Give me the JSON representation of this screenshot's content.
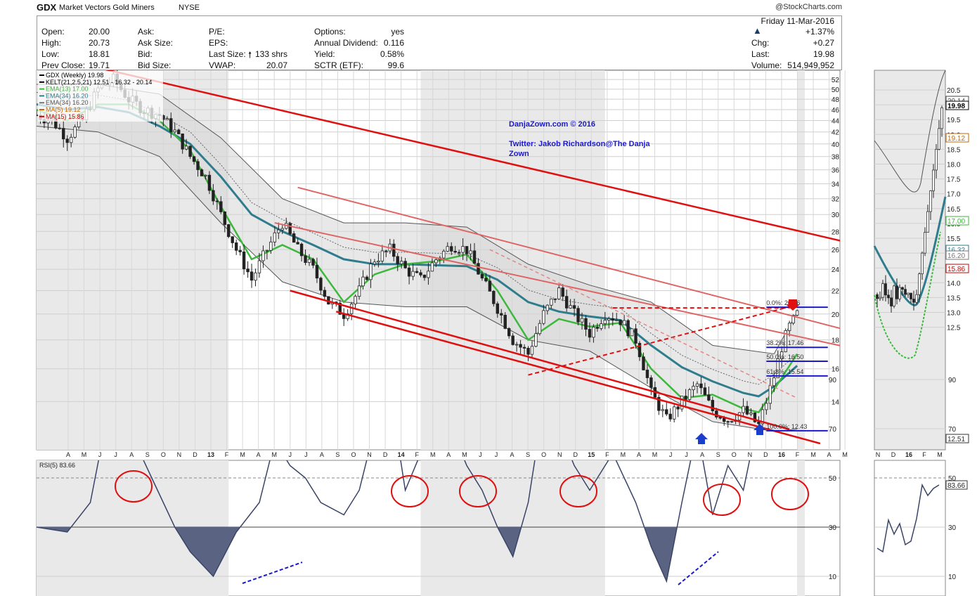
{
  "header": {
    "symbol": "GDX",
    "name": "Market Vectors Gold Miners",
    "exchange": "NYSE",
    "logo": "@StockCharts.com"
  },
  "quote": {
    "col1": [
      {
        "label": "Open:",
        "value": "20.00"
      },
      {
        "label": "High:",
        "value": "20.73"
      },
      {
        "label": "Low:",
        "value": "18.81"
      },
      {
        "label": "Prev Close:",
        "value": "19.71"
      }
    ],
    "col2": [
      {
        "label": "Ask:",
        "value": ""
      },
      {
        "label": "Ask Size:",
        "value": ""
      },
      {
        "label": "Bid:",
        "value": ""
      },
      {
        "label": "Bid Size:",
        "value": ""
      }
    ],
    "col3": [
      {
        "label": "P/E:",
        "value": ""
      },
      {
        "label": "EPS:",
        "value": ""
      },
      {
        "label": "Last Size:",
        "value": "133 shrs"
      },
      {
        "label": "VWAP:",
        "value": "20.07"
      }
    ],
    "col4": [
      {
        "label": "Options:",
        "value": "yes"
      },
      {
        "label": "Annual Dividend:",
        "value": "0.116"
      },
      {
        "label": "Yield:",
        "value": "0.58%"
      },
      {
        "label": "SCTR (ETF):",
        "value": "99.6"
      }
    ],
    "date": "Friday 11-Mar-2016",
    "change_pct": "+1.37%",
    "col5": [
      {
        "label": "Chg:",
        "value": "+0.27"
      },
      {
        "label": "Last:",
        "value": "19.98"
      },
      {
        "label": "Volume:",
        "value": "514,949,952"
      }
    ],
    "up_color": "#1a3d6a"
  },
  "legend": [
    {
      "text": "GDX (Weekly) 19.98",
      "color": "#000000"
    },
    {
      "text": "KELT(21,2.5,21) 12.51 - 16.32 - 20.14",
      "color": "#000000"
    },
    {
      "text": "EMA(13) 17.00",
      "color": "#3cb83c"
    },
    {
      "text": "EMA(34) 16.20",
      "color": "#2f7d8c"
    },
    {
      "text": "EMA(34) 16.20",
      "color": "#777777"
    },
    {
      "text": "MA(5) 19.12",
      "color": "#cc6600"
    },
    {
      "text": "MA(15) 15.86",
      "color": "#cc0000"
    }
  ],
  "watermark": {
    "line1": "DanjaZown.com © 2016",
    "line2": "Twitter: Jakob Richardson@The Danja",
    "line3": "Zown",
    "color": "#1a1acc"
  },
  "rsi": {
    "label": "RSI(5) 83.66",
    "ticks": [
      "90",
      "70",
      "50",
      "30",
      "10"
    ],
    "last": "83.66"
  },
  "side_labels": [
    "20.14",
    "19.98",
    "19.12",
    "17.00",
    "16.32",
    "16.20",
    "15.86",
    "12.51"
  ],
  "fib": [
    {
      "text": "0.0%: 20.56"
    },
    {
      "text": "38.2%: 17.46"
    },
    {
      "text": "50.0%: 16.50"
    },
    {
      "text": "61.8%: 15.54"
    },
    {
      "text": "100.0%: 12.43"
    }
  ],
  "chart_data": {
    "type": "line",
    "title": "GDX Market Vectors Gold Miners NYSE (Weekly)",
    "y_scale": "log",
    "ylim": [
      11.5,
      54
    ],
    "y_ticks": [
      52,
      50,
      48,
      46,
      44,
      42,
      40,
      38,
      36,
      34,
      32,
      30,
      28,
      26,
      24,
      22,
      20,
      18,
      16,
      14
    ],
    "x_ticks": [
      "A",
      "M",
      "J",
      "J",
      "A",
      "S",
      "O",
      "N",
      "D",
      "13",
      "F",
      "M",
      "A",
      "M",
      "J",
      "J",
      "A",
      "S",
      "O",
      "N",
      "D",
      "14",
      "F",
      "M",
      "A",
      "M",
      "J",
      "J",
      "A",
      "S",
      "O",
      "N",
      "D",
      "15",
      "F",
      "M",
      "A",
      "M",
      "J",
      "J",
      "A",
      "S",
      "O",
      "N",
      "D",
      "16",
      "F",
      "M",
      "A",
      "M"
    ],
    "price_path": [
      [
        0,
        45
      ],
      [
        4,
        44
      ],
      [
        8,
        41
      ],
      [
        12,
        44
      ],
      [
        16,
        50
      ],
      [
        20,
        52
      ],
      [
        24,
        48
      ],
      [
        28,
        46
      ],
      [
        32,
        45
      ],
      [
        36,
        42
      ],
      [
        40,
        38
      ],
      [
        44,
        35
      ],
      [
        48,
        30
      ],
      [
        52,
        26
      ],
      [
        56,
        23
      ],
      [
        60,
        26
      ],
      [
        64,
        29
      ],
      [
        68,
        26
      ],
      [
        72,
        24
      ],
      [
        76,
        21
      ],
      [
        80,
        20
      ],
      [
        84,
        22
      ],
      [
        88,
        25
      ],
      [
        92,
        26
      ],
      [
        96,
        24
      ],
      [
        100,
        23
      ],
      [
        104,
        25
      ],
      [
        108,
        26.5
      ],
      [
        112,
        26
      ],
      [
        116,
        23
      ],
      [
        120,
        20.5
      ],
      [
        124,
        18
      ],
      [
        128,
        17
      ],
      [
        132,
        20
      ],
      [
        136,
        22
      ],
      [
        140,
        20
      ],
      [
        144,
        18.5
      ],
      [
        148,
        20
      ],
      [
        152,
        19.5
      ],
      [
        156,
        18
      ],
      [
        160,
        14.5
      ],
      [
        164,
        13
      ],
      [
        168,
        14
      ],
      [
        172,
        15
      ],
      [
        176,
        13.5
      ],
      [
        180,
        13
      ],
      [
        184,
        13.5
      ],
      [
        188,
        12.7
      ],
      [
        190,
        14
      ],
      [
        192,
        15.5
      ],
      [
        194,
        17.5
      ],
      [
        196,
        19
      ],
      [
        198,
        19.98
      ]
    ],
    "series": [
      {
        "name": "EMA(13)",
        "values": [
          [
            0,
            46
          ],
          [
            8,
            44
          ],
          [
            16,
            47
          ],
          [
            24,
            47
          ],
          [
            32,
            44
          ],
          [
            40,
            39
          ],
          [
            48,
            31
          ],
          [
            56,
            25
          ],
          [
            64,
            26.5
          ],
          [
            72,
            25
          ],
          [
            80,
            21
          ],
          [
            88,
            23.5
          ],
          [
            96,
            24.5
          ],
          [
            104,
            24.8
          ],
          [
            112,
            25.5
          ],
          [
            120,
            22
          ],
          [
            128,
            18
          ],
          [
            136,
            19.6
          ],
          [
            144,
            19
          ],
          [
            152,
            19.3
          ],
          [
            160,
            16
          ],
          [
            168,
            14.2
          ],
          [
            176,
            14.4
          ],
          [
            184,
            13.6
          ],
          [
            188,
            13.4
          ],
          [
            192,
            14.7
          ],
          [
            198,
            17
          ]
        ]
      },
      {
        "name": "EMA(34)",
        "values": [
          [
            0,
            47
          ],
          [
            8,
            46
          ],
          [
            16,
            46.5
          ],
          [
            24,
            45.5
          ],
          [
            32,
            43
          ],
          [
            40,
            40
          ],
          [
            48,
            35
          ],
          [
            56,
            30
          ],
          [
            64,
            28
          ],
          [
            72,
            26.5
          ],
          [
            80,
            25
          ],
          [
            88,
            24.5
          ],
          [
            96,
            24.5
          ],
          [
            104,
            24.4
          ],
          [
            112,
            24.3
          ],
          [
            120,
            23
          ],
          [
            128,
            21
          ],
          [
            136,
            20.2
          ],
          [
            144,
            19.8
          ],
          [
            152,
            19.5
          ],
          [
            160,
            17.6
          ],
          [
            168,
            16.1
          ],
          [
            176,
            15.2
          ],
          [
            184,
            14.5
          ],
          [
            188,
            14.3
          ],
          [
            192,
            14.9
          ],
          [
            198,
            16.2
          ]
        ]
      },
      {
        "name": "KELT upper",
        "values": [
          [
            0,
            51
          ],
          [
            16,
            51
          ],
          [
            32,
            49
          ],
          [
            48,
            41
          ],
          [
            64,
            32
          ],
          [
            80,
            29
          ],
          [
            96,
            29
          ],
          [
            112,
            28.5
          ],
          [
            128,
            24.5
          ],
          [
            144,
            22.5
          ],
          [
            160,
            21
          ],
          [
            176,
            17.6
          ],
          [
            192,
            17
          ],
          [
            198,
            20.14
          ]
        ]
      },
      {
        "name": "KELT lower",
        "values": [
          [
            0,
            43
          ],
          [
            16,
            42
          ],
          [
            32,
            38
          ],
          [
            48,
            29
          ],
          [
            64,
            22.8
          ],
          [
            80,
            21
          ],
          [
            96,
            20.6
          ],
          [
            112,
            20.6
          ],
          [
            128,
            18
          ],
          [
            144,
            17.2
          ],
          [
            160,
            14.8
          ],
          [
            176,
            12.9
          ],
          [
            192,
            12.4
          ],
          [
            198,
            12.51
          ]
        ]
      }
    ],
    "trendlines": [
      {
        "from": [
          -10,
          60
        ],
        "to": [
          214,
          26.5
        ]
      },
      {
        "from": [
          66,
          22
        ],
        "to": [
          196,
          12.5
        ]
      },
      {
        "from": [
          78,
          20.2
        ],
        "to": [
          204,
          11.8
        ]
      },
      {
        "from": [
          62,
          29
        ],
        "to": [
          214,
          17.3
        ]
      },
      {
        "from": [
          68,
          33.5
        ],
        "to": [
          214,
          18.5
        ]
      }
    ],
    "rsi_values": [
      [
        0,
        30
      ],
      [
        8,
        28
      ],
      [
        14,
        40
      ],
      [
        20,
        88
      ],
      [
        24,
        70
      ],
      [
        30,
        50
      ],
      [
        36,
        30
      ],
      [
        40,
        20
      ],
      [
        46,
        10
      ],
      [
        52,
        28
      ],
      [
        58,
        40
      ],
      [
        62,
        65
      ],
      [
        66,
        55
      ],
      [
        70,
        50
      ],
      [
        74,
        40
      ],
      [
        80,
        35
      ],
      [
        84,
        45
      ],
      [
        88,
        70
      ],
      [
        92,
        85
      ],
      [
        96,
        45
      ],
      [
        100,
        60
      ],
      [
        104,
        85
      ],
      [
        108,
        70
      ],
      [
        112,
        55
      ],
      [
        116,
        45
      ],
      [
        120,
        30
      ],
      [
        124,
        18
      ],
      [
        128,
        40
      ],
      [
        132,
        80
      ],
      [
        136,
        70
      ],
      [
        140,
        55
      ],
      [
        144,
        45
      ],
      [
        150,
        60
      ],
      [
        156,
        40
      ],
      [
        160,
        22
      ],
      [
        164,
        8
      ],
      [
        168,
        40
      ],
      [
        172,
        70
      ],
      [
        176,
        35
      ],
      [
        180,
        55
      ],
      [
        184,
        45
      ],
      [
        188,
        75
      ],
      [
        192,
        85
      ],
      [
        198,
        83.66
      ]
    ]
  }
}
